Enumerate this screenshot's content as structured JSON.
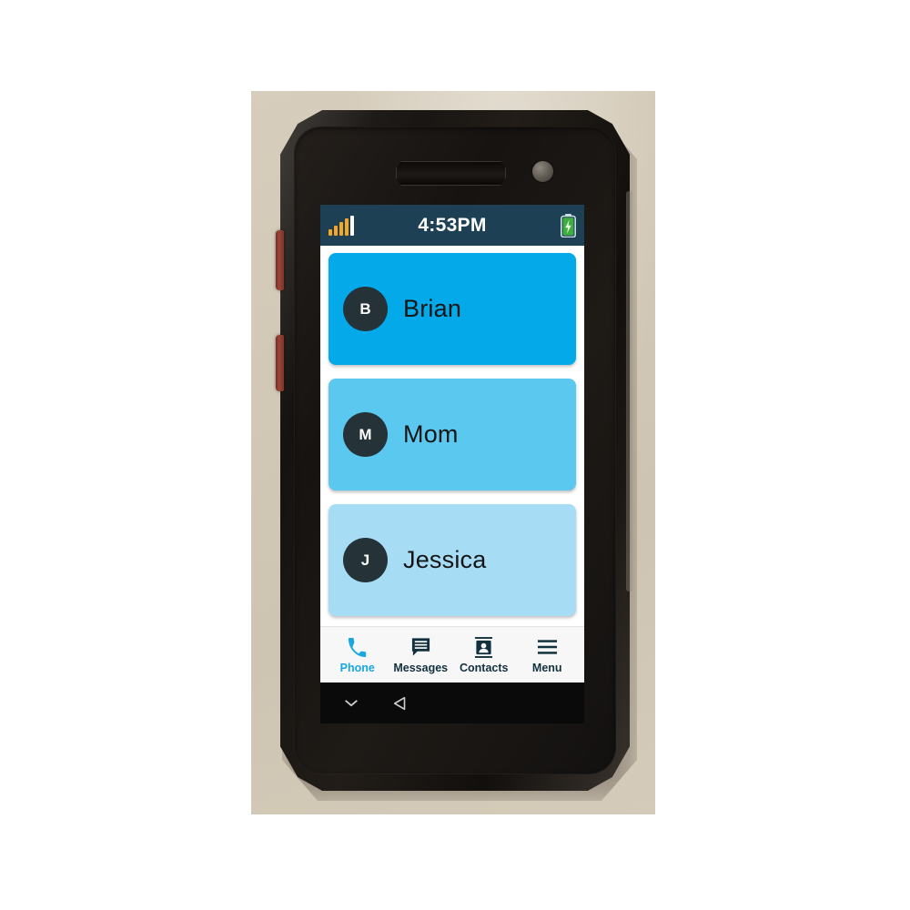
{
  "scene": {
    "device": "rugged-android-phone",
    "backdrop_color": "#d2c8b6",
    "body_color": "#161311"
  },
  "status_bar": {
    "time": "4:53PM",
    "signal_icon": "signal-bars-icon",
    "signal_bars": 4,
    "signal_color": "#f5a623",
    "battery_icon": "battery-charging-icon",
    "battery_color": "#3fae3f",
    "background": "#1d4054",
    "text_color": "#ffffff"
  },
  "contacts": [
    {
      "name": "Brian",
      "initial": "B",
      "color": "#03a9e8",
      "avatar_color": "#253238"
    },
    {
      "name": "Mom",
      "initial": "M",
      "color": "#5ac8ef",
      "avatar_color": "#253238"
    },
    {
      "name": "Jessica",
      "initial": "J",
      "color": "#a7dcf5",
      "avatar_color": "#253238"
    }
  ],
  "bottom_nav": {
    "active": "Phone",
    "active_color": "#18a7e0",
    "inactive_color": "#12313f",
    "items": [
      {
        "label": "Phone",
        "icon": "phone-handset-icon",
        "active": true
      },
      {
        "label": "Messages",
        "icon": "message-bubble-icon",
        "active": false
      },
      {
        "label": "Contacts",
        "icon": "contact-card-icon",
        "active": false
      },
      {
        "label": "Menu",
        "icon": "hamburger-menu-icon",
        "active": false
      }
    ]
  },
  "android_nav": {
    "buttons": [
      {
        "name": "hide-keyboard",
        "icon": "chevron-down-icon"
      },
      {
        "name": "back",
        "icon": "back-triangle-icon"
      }
    ]
  },
  "hardware": {
    "earpiece": "earpiece-speaker-slot",
    "camera": "front-camera-lens",
    "side_buttons": [
      "volume-up-button",
      "volume-down-button"
    ]
  }
}
